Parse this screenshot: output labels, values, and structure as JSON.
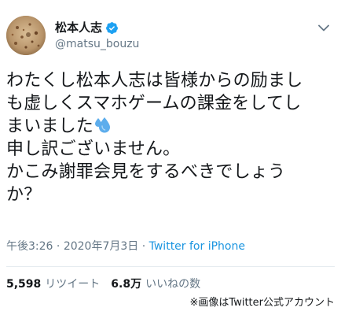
{
  "user": {
    "display_name": "松本人志",
    "handle": "@matsu_bouzu",
    "verified": true
  },
  "tweet": {
    "lines": [
      "わたくし松本人志は皆様からの励まし",
      "も虚しくスマホゲームの課金をしてし",
      "まいました",
      "申し訳ございません。",
      "かこみ謝罪会見をするべきでしょう",
      "か？"
    ],
    "emoji": "sweat-droplets"
  },
  "meta": {
    "time": "午後3:26",
    "separator": " · ",
    "date": "2020年7月3日",
    "source": "Twitter for iPhone"
  },
  "stats": {
    "retweets_count": "5,598",
    "retweets_label": "リツイート",
    "likes_count": "6.8万",
    "likes_label": "いいねの数"
  },
  "credit": "※画像はTwitter公式アカウント",
  "colors": {
    "text": "#14171a",
    "secondary": "#657786",
    "link": "#1b95e0",
    "verified": "#1da1f2",
    "divider": "#e6ecf0"
  }
}
